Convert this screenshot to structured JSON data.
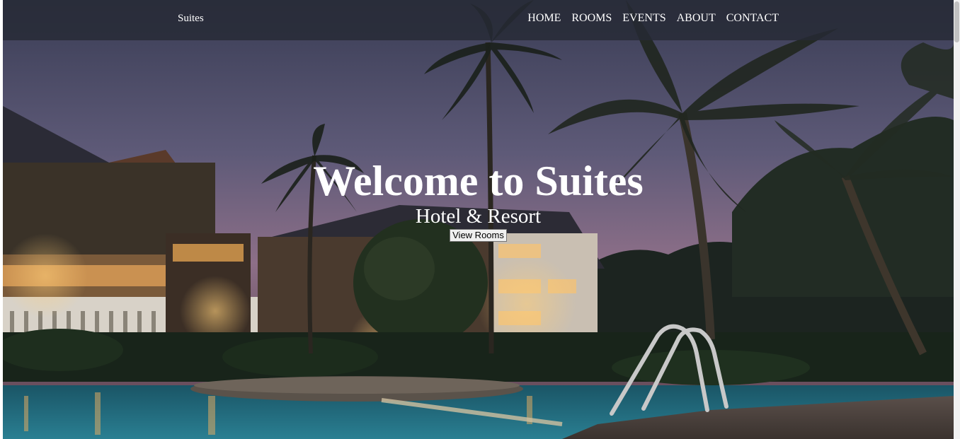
{
  "nav": {
    "brand": "Suites",
    "links": [
      "HOME",
      "ROOMS",
      "EVENTS",
      "ABOUT",
      "CONTACT"
    ]
  },
  "hero": {
    "title": "Welcome to Suites",
    "subtitle": "Hotel & Resort",
    "button_label": "View Rooms"
  },
  "colors": {
    "navbar_bg": "#262a34",
    "text": "#ffffff",
    "sky_top": "#3b3d55",
    "sky_bottom": "#8a6f8a",
    "pool": "#1f6c82"
  }
}
